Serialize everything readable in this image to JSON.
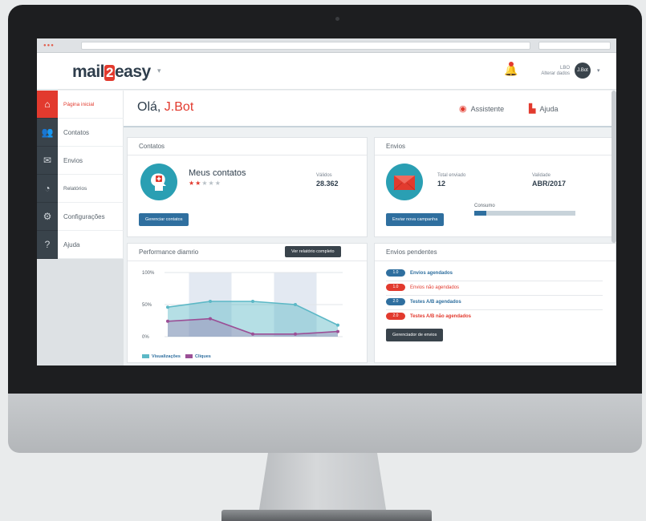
{
  "app": {
    "logo_text_1": "mail",
    "logo_text_2": "2",
    "logo_text_3": "easy"
  },
  "user": {
    "name": "LBO",
    "subtitle": "Alterar dados",
    "avatar_text": "J.Bot"
  },
  "nav": {
    "items": [
      {
        "label": "Página inicial",
        "icon": "home-icon"
      },
      {
        "label": "Contatos",
        "icon": "contacts-icon"
      },
      {
        "label": "Envios",
        "icon": "mail-icon"
      },
      {
        "label": "Relatórios",
        "icon": "reports-icon"
      },
      {
        "label": "Configurações",
        "icon": "gear-icon"
      },
      {
        "label": "Ajuda",
        "icon": "help-icon"
      }
    ]
  },
  "greeting": {
    "prefix": "Olá,",
    "name": "J.Bot"
  },
  "header_actions": {
    "assistant": "Assistente",
    "help": "Ajuda"
  },
  "contatos_card": {
    "title": "Contatos",
    "heading": "Meus contatos",
    "rating": 2,
    "rating_max": 5,
    "valid_label": "Válidos",
    "valid_value": "28.362",
    "button": "Gerenciar contatos"
  },
  "envios_card": {
    "title": "Envios",
    "total_label": "Total enviado",
    "total_value": "12",
    "validity_label": "Validade",
    "validity_value": "ABR/2017",
    "consumption_label": "Consumo",
    "consumption_fraction": 0.12,
    "button": "Enviar nova campanha"
  },
  "performance_card": {
    "title": "Performance diamrio",
    "button": "Ver relatório completo"
  },
  "recent_card": {
    "title": "Envios pendentes",
    "items": [
      {
        "tag": "1.0",
        "text": "Envios agendados",
        "color": "#2f6f9f"
      },
      {
        "tag": "1.0",
        "text": "Envios não agendados",
        "color": "#e23a2e"
      },
      {
        "tag": "2.0",
        "text": "Testes A/B agendados",
        "color": "#2f6f9f"
      },
      {
        "tag": "2.0",
        "text": "Testes A/B não agendados",
        "color": "#e23a2e"
      }
    ],
    "button": "Gerenciador de envios"
  },
  "chart_data": {
    "type": "area",
    "x": [
      1,
      2,
      3,
      4,
      5
    ],
    "ylim": [
      0,
      100
    ],
    "yticks": [
      "100%",
      "50%",
      "0%"
    ],
    "series": [
      {
        "name": "Visualizações",
        "color": "#5cb8c6",
        "values": [
          46,
          55,
          55,
          50,
          18
        ]
      },
      {
        "name": "Cliques",
        "color": "#9b4f96",
        "values": [
          24,
          28,
          4,
          4,
          8
        ]
      }
    ]
  },
  "colors": {
    "brand_red": "#e23a2e",
    "dark_slate": "#39434b",
    "accent_blue": "#2f6f9f",
    "teal": "#2a9fb3"
  }
}
